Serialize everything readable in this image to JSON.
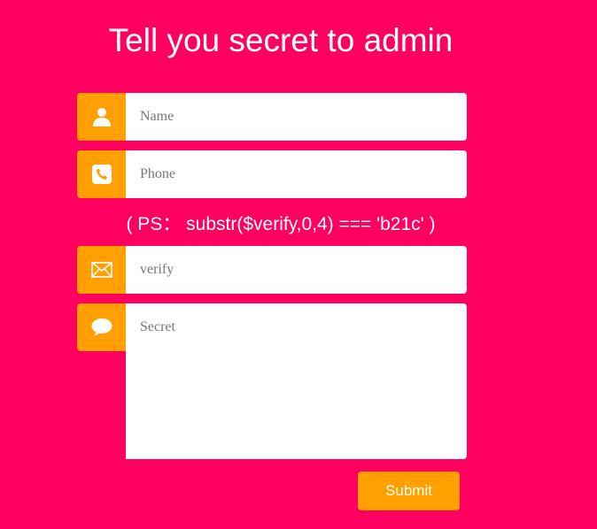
{
  "title": "Tell you secret to admin",
  "form": {
    "name": {
      "placeholder": "Name",
      "value": "",
      "icon": "user-icon"
    },
    "phone": {
      "placeholder": "Phone",
      "value": "",
      "icon": "phone-icon"
    },
    "hint": "( PS： substr($verify,0,4) === 'b21c' )",
    "verify": {
      "placeholder": "verify",
      "value": "",
      "icon": "envelope-icon"
    },
    "secret": {
      "placeholder": "Secret",
      "value": "",
      "icon": "chat-bubble-icon"
    },
    "submit_label": "Submit"
  },
  "colors": {
    "background": "#ff0060",
    "accent": "#ffa000",
    "field": "#ffffff",
    "text": "#ffffff"
  }
}
